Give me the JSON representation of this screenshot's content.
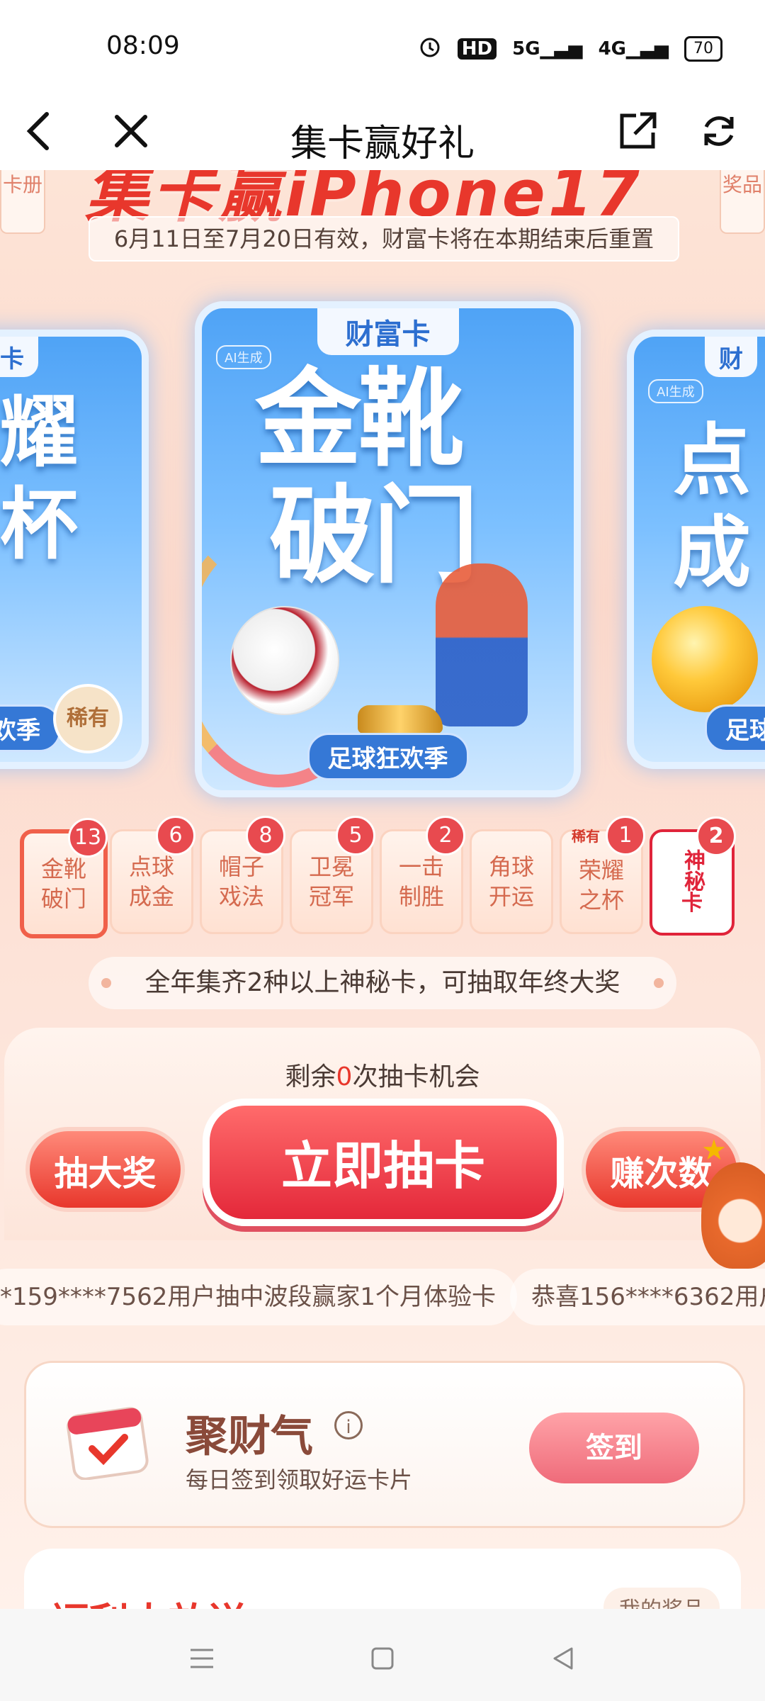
{
  "status_bar": {
    "time": "08:09",
    "hd_label": "HD",
    "net5g_label": "5G",
    "net4g_label": "4G",
    "battery": "70"
  },
  "nav": {
    "title": "集卡赢好礼",
    "back_icon": "chevron-left-icon",
    "close_icon": "close-icon",
    "share_icon": "share-icon",
    "refresh_icon": "refresh-icon"
  },
  "hero": {
    "title": "集卡赢iPhone17",
    "left_tab": "卡册",
    "right_tab": "奖品",
    "validity": "6月11日至7月20日有效，财富卡将在本期结束后重置"
  },
  "cards": {
    "center": {
      "label": "财富卡",
      "ai_tag": "AI生成",
      "line1": "金靴",
      "line2": "破门",
      "foot": "足球狂欢季"
    },
    "left": {
      "label": "卡",
      "line1": "耀",
      "line2": "杯",
      "foot": "欢季",
      "rare": "稀有"
    },
    "right": {
      "label": "财",
      "ai_tag": "AI生成",
      "line1": "点",
      "line2": "成",
      "foot": "足球"
    }
  },
  "card_chips": [
    {
      "line1": "金靴",
      "line2": "破门",
      "count": "13"
    },
    {
      "line1": "点球",
      "line2": "成金",
      "count": "6"
    },
    {
      "line1": "帽子",
      "line2": "戏法",
      "count": "8"
    },
    {
      "line1": "卫冕",
      "line2": "冠军",
      "count": "5"
    },
    {
      "line1": "一击",
      "line2": "制胜",
      "count": "2"
    },
    {
      "line1": "角球",
      "line2": "开运",
      "count": ""
    },
    {
      "line1": "荣耀",
      "line2": "之杯",
      "count": "1",
      "rare": "稀有"
    },
    {
      "line1": "神秘",
      "line2": "卡",
      "count": "2"
    }
  ],
  "collect_tip": "全年集齐2种以上神秘卡，可抽取年终大奖",
  "draw": {
    "count_prefix": "剩余",
    "count_value": "0",
    "count_suffix": "次抽卡机会",
    "draw_now": "立即抽卡",
    "grand_prize": "抽大奖",
    "earn_chances": "赚次数"
  },
  "ticker": [
    "*159****7562用户抽中波段赢家1个月体验卡",
    "恭喜156****6362用户"
  ],
  "signin": {
    "title": "聚财气",
    "info_icon": "info-icon",
    "subtitle": "每日签到领取好运卡片",
    "button": "签到"
  },
  "welfare": {
    "title": "福利大放送",
    "my_prize": "我的奖品"
  },
  "colors": {
    "accent_red": "#e8372c",
    "card_blue": "#4fa3f6",
    "bg_peach": "#fde4d7"
  }
}
